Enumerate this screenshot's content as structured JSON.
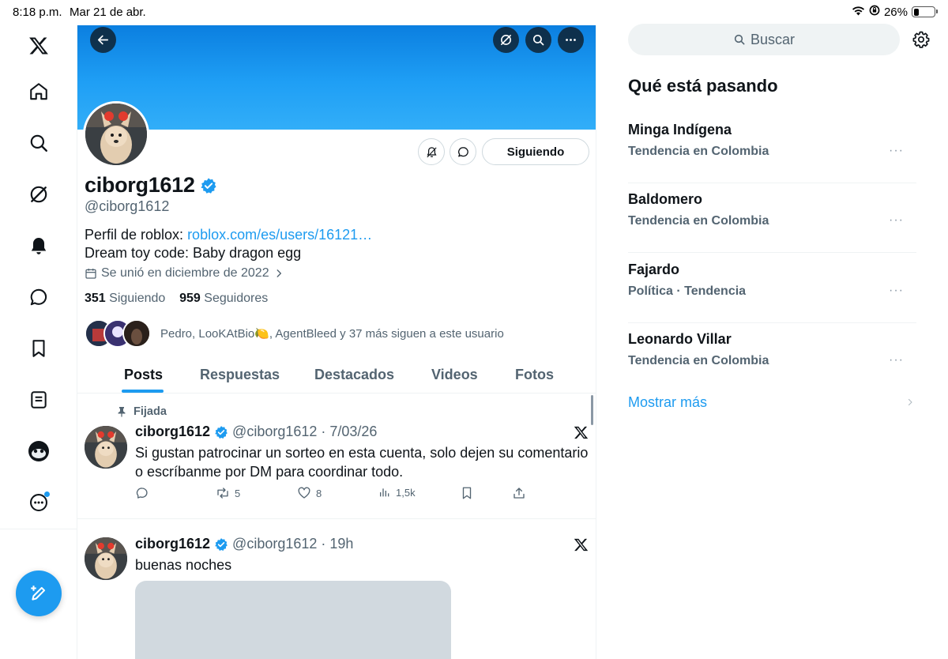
{
  "status_bar": {
    "time": "8:18 p.m.",
    "date": "Mar 21 de abr.",
    "battery_text": "26%",
    "battery_level": 0.26
  },
  "nav": {
    "icons": [
      "x-logo-icon",
      "home-icon",
      "search-icon",
      "grok-icon",
      "notifications-icon",
      "messages-icon",
      "bookmarks-icon",
      "lists-icon",
      "profile-avatar-icon",
      "more-icon"
    ],
    "compose_icon": "compose-icon"
  },
  "profile": {
    "display_name": "ciborg1612",
    "handle": "@ciborg1612",
    "bio_prefix": "Perfil de roblox: ",
    "bio_link": "roblox.com/es/users/16121…",
    "bio_line2": "Dream toy code: Baby dragon egg",
    "joined": "Se unió en diciembre de 2022",
    "following_count": "351",
    "following_label": "Siguiendo",
    "followers_count": "959",
    "followers_label": "Seguidores",
    "followed_by": "Pedro, LooKAtBio🍋, AgentBleed y 37 más siguen a este usuario",
    "follow_button": "Siguiendo"
  },
  "tabs": [
    "Posts",
    "Respuestas",
    "Destacados",
    "Videos",
    "Fotos"
  ],
  "active_tab": "Posts",
  "tweets": [
    {
      "pinned_label": "Fijada",
      "name": "ciborg1612",
      "handle": "@ciborg1612",
      "date": "7/03/26",
      "text": "Si gustan patrocinar un sorteo en esta cuenta, solo dejen su comentario o escríbanme por DM para coordinar todo.",
      "retweets": "5",
      "likes": "8",
      "views": "1,5k"
    },
    {
      "name": "ciborg1612",
      "handle": "@ciborg1612",
      "date": "19h",
      "text": "buenas noches"
    }
  ],
  "sidebar": {
    "search_placeholder": "Buscar",
    "trends_title": "Qué está pasando",
    "trends": [
      {
        "name": "Minga Indígena",
        "context": "Tendencia en Colombia"
      },
      {
        "name": "Baldomero",
        "context": "Tendencia en Colombia"
      },
      {
        "name": "Fajardo",
        "context": "Política · Tendencia"
      },
      {
        "name": "Leonardo Villar",
        "context": "Tendencia en Colombia"
      }
    ],
    "show_more": "Mostrar más",
    "more_glyph": "···"
  },
  "colors": {
    "accent": "#1d9bf0",
    "text_primary": "#0f1419",
    "text_secondary": "#536471",
    "banner": "#1d9bf0"
  }
}
